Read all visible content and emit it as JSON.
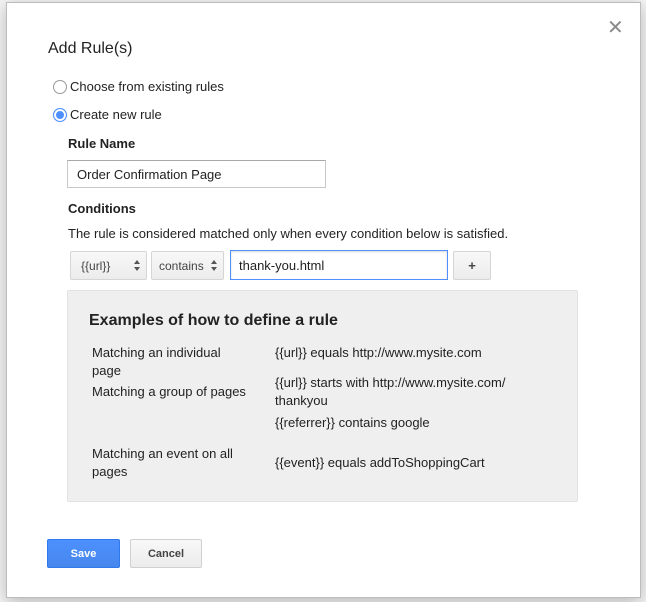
{
  "dialog": {
    "title": "Add Rule(s)",
    "close_glyph": "✕"
  },
  "mode": {
    "options": [
      {
        "label": "Choose from existing rules",
        "checked": false
      },
      {
        "label": "Create new rule",
        "checked": true
      }
    ]
  },
  "rule_name": {
    "label": "Rule Name",
    "value": "Order Confirmation Page"
  },
  "conditions": {
    "label": "Conditions",
    "description": "The rule is considered matched only when every condition below is satisfied.",
    "variable_selected": "{{url}}",
    "operator_selected": "contains",
    "value": "thank-you.html",
    "add_label": "+"
  },
  "examples": {
    "title": "Examples of how to define a rule",
    "rows": [
      {
        "label": "Matching an individual page",
        "value": "{{url}} equals http://www.mysite.com"
      },
      {
        "label": "Matching a group of pages",
        "value": "{{url}} starts with http://www.mysite.com/ thankyou",
        "value2": "{{referrer}} contains google"
      },
      {
        "label": "Matching an event on all pages",
        "value": "{{event}} equals addToShoppingCart"
      }
    ]
  },
  "actions": {
    "save_label": "Save",
    "cancel_label": "Cancel"
  },
  "colors": {
    "accent": "#4d90fe",
    "examples_bg": "#efefef"
  }
}
